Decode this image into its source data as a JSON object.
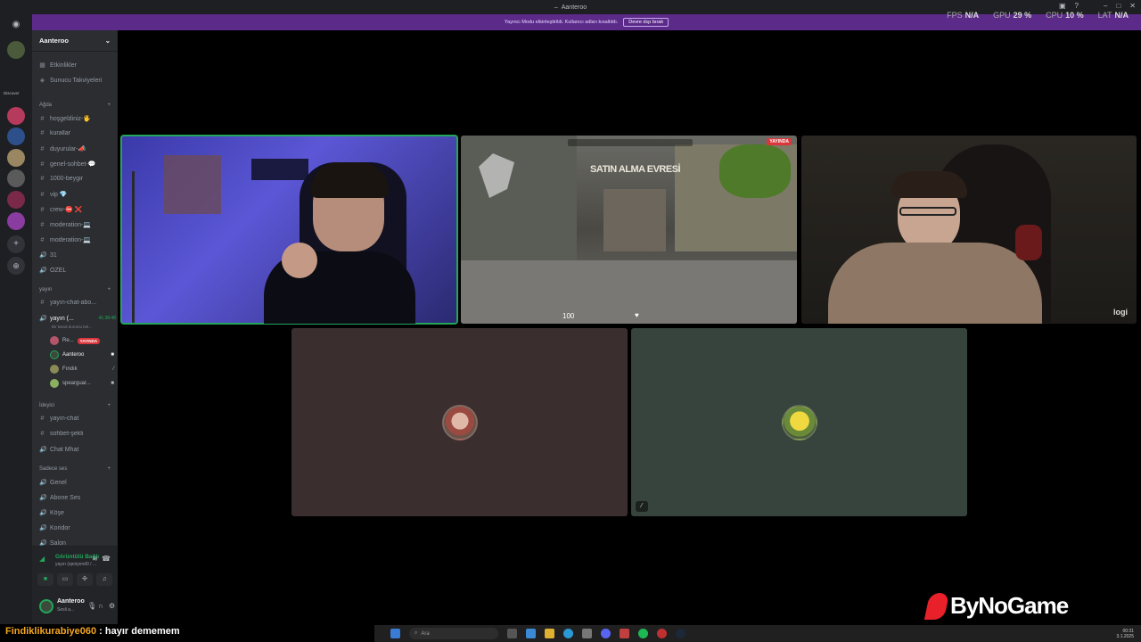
{
  "window": {
    "title": "Aanteroo"
  },
  "notice": {
    "text": "Yayıncı Modu etkinleştirildi. Kullanıcı adları kısaltıldı.",
    "button": "Devre dışı bırak"
  },
  "stats": [
    {
      "label": "FPS",
      "value": "N/A"
    },
    {
      "label": "GPU",
      "value": "29 %"
    },
    {
      "label": "CPU",
      "value": "10 %"
    },
    {
      "label": "LAT",
      "value": "N/A"
    }
  ],
  "rail": {
    "section_label": "Discover"
  },
  "server": {
    "name": "Aanteroo",
    "top_items": [
      {
        "icon": "calendar-icon",
        "glyph": "▦",
        "label": "Etkinlikler"
      },
      {
        "icon": "boost-icon",
        "glyph": "◈",
        "label": "Sunucu Takviyeleri"
      }
    ],
    "categories": [
      {
        "label": "Ağda",
        "channels": [
          {
            "glyph": "#",
            "label": "hoşgeldiniz-🖐"
          },
          {
            "glyph": "#",
            "label": "kurallar"
          },
          {
            "glyph": "#",
            "label": "duyurular-📣"
          },
          {
            "glyph": "#",
            "label": "genel-sohbet-💬"
          },
          {
            "glyph": "#",
            "label": "1000-beygir"
          },
          {
            "glyph": "#",
            "label": "vip 💎"
          },
          {
            "glyph": "#",
            "label": "crew-⛔ ❌"
          },
          {
            "glyph": "#",
            "label": "moderation-💻"
          },
          {
            "glyph": "#",
            "label": "moderation-💻"
          },
          {
            "glyph": "🔊",
            "label": "31"
          },
          {
            "glyph": "🔊",
            "label": "ÖZEL"
          }
        ]
      },
      {
        "label": "yayın",
        "channels": [
          {
            "glyph": "#",
            "label": "yayın-chat-abo..."
          }
        ]
      }
    ],
    "active_voice": {
      "label": "yayın (...",
      "timer": "41:38:48",
      "status": "Bir kanal durumu bel..."
    },
    "voice_users": [
      {
        "name": "Re...",
        "live": "YAYINDA",
        "color": "#b4566a"
      },
      {
        "name": "Aanteroo",
        "live": "",
        "color": "#3c4a3c"
      },
      {
        "name": "Fındık",
        "live": "",
        "color": "#8a8a56"
      },
      {
        "name": "spearguar...",
        "live": "",
        "color": "#8ab060"
      }
    ],
    "categories2": [
      {
        "label": "İdeyici",
        "channels": [
          {
            "glyph": "#",
            "label": "yayın-chat"
          },
          {
            "glyph": "#",
            "label": "sohbet-şekli"
          },
          {
            "glyph": "🔊",
            "label": "Chat Mhat"
          }
        ]
      },
      {
        "label": "Sadece ses",
        "channels": [
          {
            "glyph": "🔊",
            "label": "Genel"
          },
          {
            "glyph": "🔊",
            "label": "Abone Ses"
          },
          {
            "glyph": "🔊",
            "label": "Köşe"
          },
          {
            "glyph": "🔊",
            "label": "Koridor"
          },
          {
            "glyph": "🔊",
            "label": "Salon"
          }
        ]
      }
    ]
  },
  "voice_panel": {
    "title": "Görüntülü Bağlı",
    "subtitle": "yayın (spoiyerel0 / ..."
  },
  "user_panel": {
    "name": "Aanteroo",
    "status": "Sesli a..."
  },
  "stage": {
    "game_banner": "SATIN ALMA EVRESİ",
    "game_hp": "100",
    "live_badge": "YAYINDA",
    "cam_brand": "logi"
  },
  "overlay": {
    "chat_nick": "Findiklikurabiye060",
    "chat_sep": " : ",
    "chat_msg": "hayır dememem",
    "brand": "ByNoGame"
  },
  "taskbar": {
    "search_placeholder": "Ara",
    "time": "00:31",
    "date": "3.1.2025"
  },
  "colors": {
    "accent_green": "#23a55a",
    "notice_purple": "#5c2b8a",
    "live_red": "#da373c"
  }
}
